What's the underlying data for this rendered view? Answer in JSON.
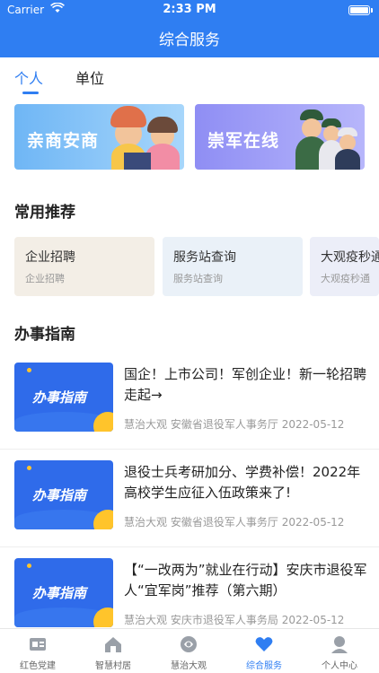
{
  "status_bar": {
    "carrier": "Carrier",
    "time": "2:33 PM"
  },
  "header": {
    "title": "综合服务"
  },
  "tabs": [
    {
      "label": "个人",
      "active": true
    },
    {
      "label": "单位",
      "active": false
    }
  ],
  "banners": [
    {
      "label": "亲商安商"
    },
    {
      "label": "崇军在线"
    }
  ],
  "recommend": {
    "title": "常用推荐",
    "items": [
      {
        "title": "企业招聘",
        "subtitle": "企业招聘"
      },
      {
        "title": "服务站查询",
        "subtitle": "服务站查询"
      },
      {
        "title": "大观疫秒通",
        "subtitle": "大观疫秒通"
      }
    ]
  },
  "guide": {
    "title": "办事指南",
    "thumb_label": "办事指南",
    "items": [
      {
        "title": "国企！上市公司！军创企业！新一轮招聘走起→",
        "source": "慧治大观",
        "org": "安徽省退役军人事务厅",
        "date": "2022-05-12"
      },
      {
        "title": "退役士兵考研加分、学费补偿！2022年高校学生应征入伍政策来了!",
        "source": "慧治大观",
        "org": "安徽省退役军人事务厅",
        "date": "2022-05-12"
      },
      {
        "title": "【“一改两为”就业在行动】安庆市退役军人“宜军岗”推荐（第六期）",
        "source": "慧治大观",
        "org": "安庆市退役军人事务局",
        "date": "2022-05-12"
      }
    ]
  },
  "tabbar": [
    {
      "label": "红色党建",
      "icon": "party-building-icon",
      "active": false
    },
    {
      "label": "智慧村居",
      "icon": "village-home-icon",
      "active": false
    },
    {
      "label": "慧治大观",
      "icon": "governance-icon",
      "active": false
    },
    {
      "label": "综合服务",
      "icon": "heart-service-icon",
      "active": true
    },
    {
      "label": "个人中心",
      "icon": "user-center-icon",
      "active": false
    }
  ],
  "colors": {
    "primary": "#2f7ef2",
    "accent_yellow": "#ffc42b"
  }
}
